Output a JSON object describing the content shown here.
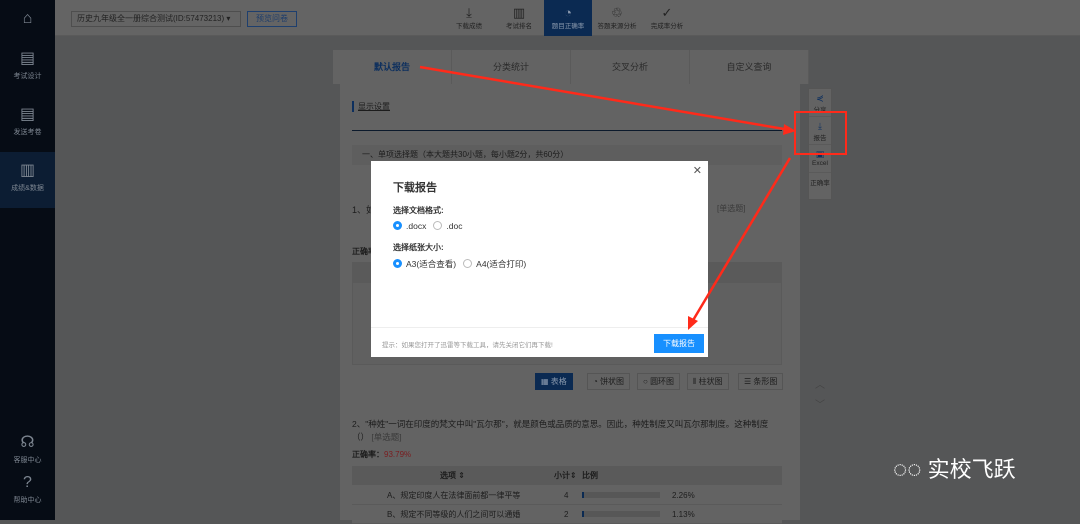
{
  "sidebar": {
    "items": [
      {
        "label": "考试设计"
      },
      {
        "label": "发送考卷"
      },
      {
        "label": "成绩&数据"
      },
      {
        "label": "客服中心"
      },
      {
        "label": "帮助中心"
      }
    ]
  },
  "topbar": {
    "exam_select": "历史九年级全一册综合测试(ID:57473213)",
    "preview_button": "预览问卷",
    "tools": [
      "下载成绩",
      "考试排名",
      "题目正确率",
      "答题来源分析",
      "完成率分析"
    ]
  },
  "tabs": [
    "默认报告",
    "分类统计",
    "交叉分析",
    "自定义查询"
  ],
  "content": {
    "display_settings": "显示设置",
    "section_title": "一、单项选择题（本大题共30小题，每小题2分，共60分）",
    "q1_prefix": "1、如",
    "q1_type": "[单选题]",
    "accuracy_label": "正确率",
    "chart_buttons": [
      "表格",
      "饼状图",
      "圆环图",
      "柱状图",
      "条形图"
    ],
    "q2_text": "2、\"种姓\"一词在印度的梵文中叫\"瓦尔那\"，就是颜色或品质的意思。因此，种姓制度又叫瓦尔那制度。这种制度（）",
    "q2_type": "[单选题]",
    "q2_accuracy_label": "正确率：",
    "q2_accuracy": "93.79%",
    "table_headers": [
      "选项 ⇕",
      "小计⇕",
      "比例"
    ],
    "rows": [
      {
        "option": "A、规定印度人在法律面前都一律平等",
        "count": "4",
        "pct": "2.26%",
        "fraction": 0.0226
      },
      {
        "option": "B、规定不同等级的人们之间可以通婚",
        "count": "2",
        "pct": "1.13%",
        "fraction": 0.0113
      }
    ]
  },
  "right_toolbar": [
    "分享",
    "报告",
    "Excel",
    "正确率"
  ],
  "modal": {
    "title": "下载报告",
    "format_label": "选择文档格式:",
    "formats": [
      ".docx",
      ".doc"
    ],
    "paper_label": "选择纸张大小:",
    "papers": [
      "A3(适合查看)",
      "A4(适合打印)"
    ],
    "tip": "提示：如果您打开了迅雷等下载工具，请先关闭它们再下载!",
    "download_button": "下载报告"
  },
  "watermark": "实校飞跃",
  "colors": {
    "primary": "#1890ff",
    "sidebar": "#0d1a2b",
    "arrow": "#ff2a1a"
  }
}
